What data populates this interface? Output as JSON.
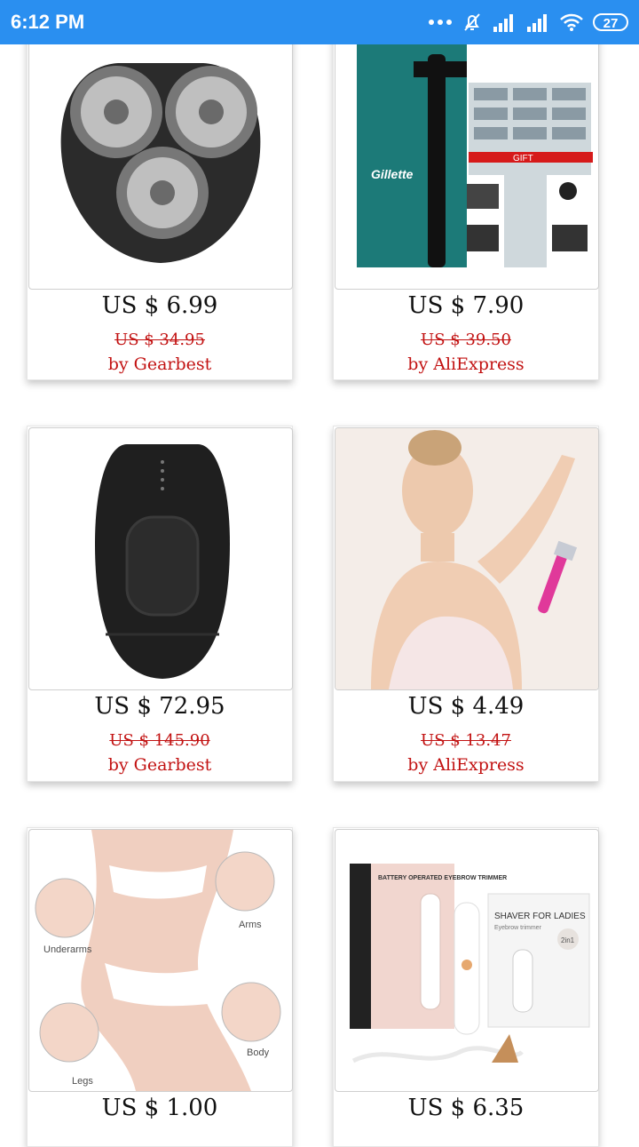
{
  "status_bar": {
    "time": "6:12 PM",
    "battery": "27"
  },
  "products": [
    {
      "price": "US $ 6.99",
      "old_price": "US $ 34.95",
      "seller": "by Gearbest",
      "image": "shaver-head"
    },
    {
      "price": "US $ 7.90",
      "old_price": "US $ 39.50",
      "seller": "by AliExpress",
      "image": "gillette-razor-pack",
      "image_text": {
        "brand": "Gillette",
        "gift": "GIFT"
      }
    },
    {
      "price": "US $ 72.95",
      "old_price": "US $ 145.90",
      "seller": "by Gearbest",
      "image": "ipl-epilator"
    },
    {
      "price": "US $ 4.49",
      "old_price": "US $ 13.47",
      "seller": "by AliExpress",
      "image": "woman-razor"
    },
    {
      "price": "US $ 1.00",
      "image": "body-areas",
      "image_text": {
        "underarms": "Underarms",
        "arms": "Arms",
        "legs": "Legs",
        "body": "Body"
      }
    },
    {
      "price": "US $ 6.35",
      "image": "ladies-trimmer",
      "image_text": {
        "title": "SHAVER FOR LADIES",
        "subtitle": "Eyebrow trimmer",
        "badge": "2in1",
        "box": "BATTERY OPERATED EYEBROW TRIMMER"
      }
    }
  ]
}
